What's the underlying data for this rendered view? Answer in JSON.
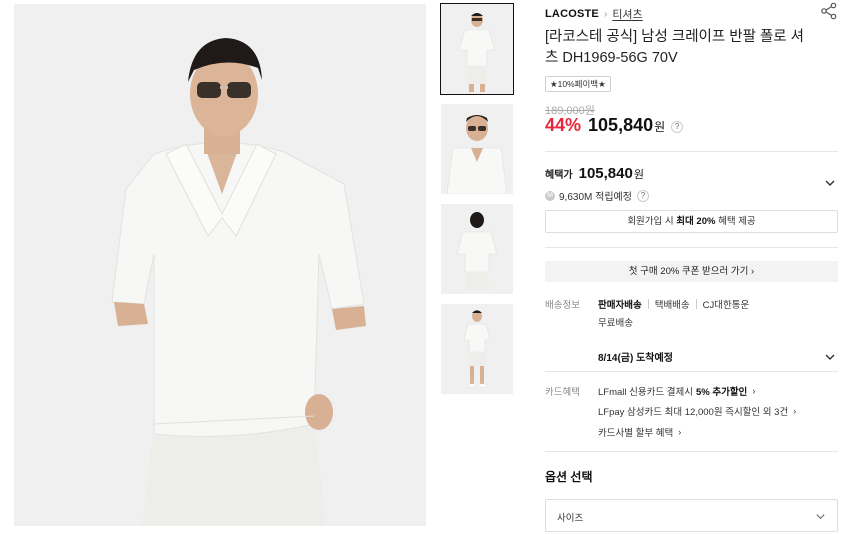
{
  "gallery": {
    "main_alt": "product-main-photo",
    "thumbnails": [
      {
        "name": "front-full"
      },
      {
        "name": "close-up"
      },
      {
        "name": "back-view"
      },
      {
        "name": "full-outfit"
      }
    ]
  },
  "product": {
    "brand": "LACOSTE",
    "breadcrumb_sep": "›",
    "category": "티셔츠",
    "title": "[라코스테 공식] 남성 크레이프 반팔 폴로 셔츠 DH1969-56G 70V",
    "promo_badge": "★10%페이백★"
  },
  "pricing": {
    "original_price": "189,000원",
    "discount": "44%",
    "price": "105,840",
    "currency": "원",
    "help": "?",
    "benefit_label": "혜택가",
    "benefit_price": "105,840",
    "points_icon": "M",
    "points_text": "9,630M 적립예정"
  },
  "membership": {
    "prefix": "회원가입 시 ",
    "highlight": "최대 20%",
    "suffix": " 혜택 제공"
  },
  "coupon": {
    "label": "첫 구매 20% 쿠폰 받으러 가기 ›"
  },
  "shipping": {
    "label": "배송정보",
    "seller": "판매자배송",
    "method": "택배배송",
    "carrier": "CJ대한통운",
    "fee": "무료배송",
    "arrival": "8/14(금) 도착예정"
  },
  "card": {
    "label": "카드혜택",
    "lines": [
      {
        "text": "LFmall 신용카드 결제시",
        "bold": "5% 추가할인",
        "arrow": "›"
      },
      {
        "text": "LFpay 삼성카드 최대 12,000원 즉시할인 외 3건",
        "bold": "",
        "arrow": "›"
      },
      {
        "text": "카드사별 할부 혜택",
        "bold": "",
        "arrow": "›"
      }
    ]
  },
  "options": {
    "title": "옵션 선택",
    "size_placeholder": "사이즈"
  },
  "colors": {
    "discount": "#e8253a",
    "shirt": "#f4f4f1",
    "background": "#f2f2f2"
  }
}
